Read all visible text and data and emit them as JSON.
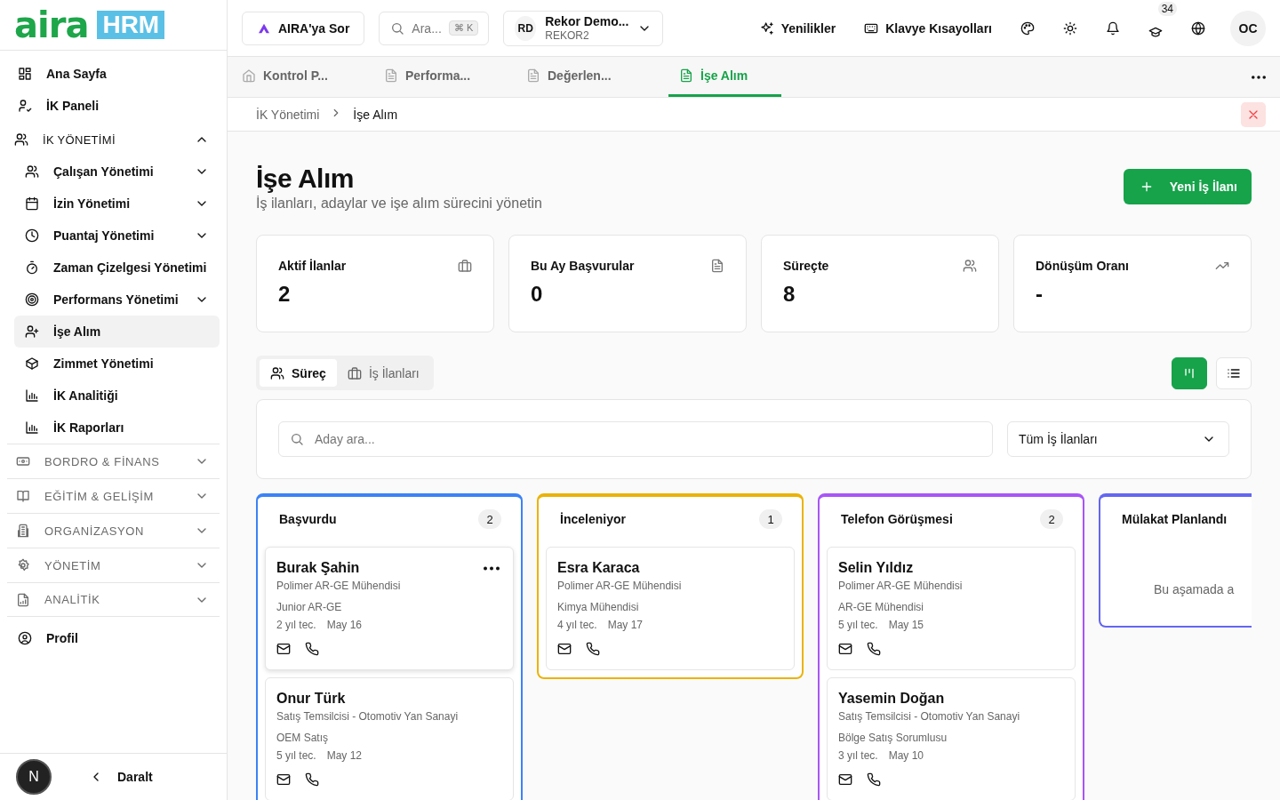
{
  "logo": {
    "wordmark": "aira",
    "badge": "HRM"
  },
  "sidebar": {
    "items": [
      {
        "kind": "link",
        "label": "Ana Sayfa",
        "selected": false
      },
      {
        "kind": "link",
        "label": "İK Paneli",
        "selected": false
      },
      {
        "kind": "group",
        "label": "İK YÖNETİMİ",
        "expanded": true,
        "children": [
          {
            "label": "Çalışan Yönetimi",
            "has_submenu": true,
            "selected": false
          },
          {
            "label": "İzin Yönetimi",
            "has_submenu": true,
            "selected": false
          },
          {
            "label": "Puantaj Yönetimi",
            "has_submenu": true,
            "selected": false
          },
          {
            "label": "Zaman Çizelgesi Yönetimi",
            "has_submenu": false,
            "selected": false
          },
          {
            "label": "Performans Yönetimi",
            "has_submenu": true,
            "selected": false
          },
          {
            "label": "İşe Alım",
            "has_submenu": false,
            "selected": true
          },
          {
            "label": "Zimmet Yönetimi",
            "has_submenu": false,
            "selected": false
          },
          {
            "label": "İK Analitiği",
            "has_submenu": false,
            "selected": false
          },
          {
            "label": "İK Raporları",
            "has_submenu": false,
            "selected": false
          }
        ]
      },
      {
        "kind": "section",
        "label": "BORDRO & FİNANS",
        "expanded": false
      },
      {
        "kind": "section",
        "label": "EĞİTİM & GELİŞİM",
        "expanded": false
      },
      {
        "kind": "section",
        "label": "ORGANİZASYON",
        "expanded": false
      },
      {
        "kind": "section",
        "label": "YÖNETİM",
        "expanded": false
      },
      {
        "kind": "section",
        "label": "ANALİTİK",
        "expanded": false
      },
      {
        "kind": "link",
        "label": "Profil",
        "selected": false
      }
    ],
    "footer": {
      "avatar": "N",
      "collapse_label": "Daralt"
    }
  },
  "topbar": {
    "ask_button": "AIRA'ya Sor",
    "search": {
      "placeholder": "Ara...",
      "shortcut": "⌘ K"
    },
    "account": {
      "initials": "RD",
      "name": "Rekor Demo...",
      "org": "REKOR2"
    },
    "news_button": "Yenilikler",
    "shortcuts_button": "Klavye Kısayolları",
    "notification_count": "34",
    "user_initials": "OC"
  },
  "tabs": [
    {
      "label": "Kontrol P...",
      "selected": false
    },
    {
      "label": "Performa...",
      "selected": false
    },
    {
      "label": "Değerlen...",
      "selected": false
    },
    {
      "label": "İşe Alım",
      "selected": true
    }
  ],
  "breadcrumb": [
    "İK Yönetimi",
    "İşe Alım"
  ],
  "page": {
    "title": "İşe Alım",
    "subtitle": "İş ilanları, adaylar ve işe alım sürecini yönetin",
    "primary_button": "Yeni İş İlanı"
  },
  "stats": [
    {
      "label": "Aktif İlanlar",
      "value": "2"
    },
    {
      "label": "Bu Ay Başvurular",
      "value": "0"
    },
    {
      "label": "Süreçte",
      "value": "8"
    },
    {
      "label": "Dönüşüm Oranı",
      "value": "-"
    }
  ],
  "view_tabs": [
    {
      "label": "Süreç",
      "selected": true
    },
    {
      "label": "İş İlanları",
      "selected": false
    }
  ],
  "view_toggles": [
    {
      "kind": "board",
      "selected": true
    },
    {
      "kind": "list",
      "selected": false
    }
  ],
  "filters": {
    "search_placeholder": "Aday ara...",
    "job_select": "Tüm İş İlanları"
  },
  "columns": [
    {
      "title": "Başvurdu",
      "count": "2",
      "color": "#3b82f6",
      "cards": [
        {
          "name": "Burak Şahin",
          "position": "Polimer AR-GE Mühendisi",
          "role": "Junior AR-GE",
          "experience": "2 yıl tec.",
          "date": "May 16",
          "menu_visible": true
        },
        {
          "name": "Onur Türk",
          "position": "Satış Temsilcisi - Otomotiv Yan Sanayi",
          "role": "OEM Satış",
          "experience": "5 yıl tec.",
          "date": "May 12",
          "menu_visible": false
        }
      ]
    },
    {
      "title": "İnceleniyor",
      "count": "1",
      "color": "#eab308",
      "cards": [
        {
          "name": "Esra Karaca",
          "position": "Polimer AR-GE Mühendisi",
          "role": "Kimya Mühendisi",
          "experience": "4 yıl tec.",
          "date": "May 17",
          "menu_visible": false
        }
      ]
    },
    {
      "title": "Telefon Görüşmesi",
      "count": "2",
      "color": "#a855f7",
      "cards": [
        {
          "name": "Selin Yıldız",
          "position": "Polimer AR-GE Mühendisi",
          "role": "AR-GE Mühendisi",
          "experience": "5 yıl tec.",
          "date": "May 15",
          "menu_visible": false
        },
        {
          "name": "Yasemin Doğan",
          "position": "Satış Temsilcisi - Otomotiv Yan Sanayi",
          "role": "Bölge Satış Sorumlusu",
          "experience": "3 yıl tec.",
          "date": "May 10",
          "menu_visible": false
        }
      ]
    },
    {
      "title": "Mülakat Planlandı",
      "color": "#6366f1",
      "empty_text": "Bu aşamada a"
    }
  ]
}
